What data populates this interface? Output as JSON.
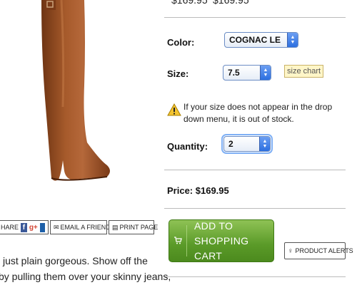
{
  "product": {
    "prices_top": [
      "$169.95",
      "$169.95"
    ],
    "color_label": "Color:",
    "color_value": "COGNAC LE",
    "size_label": "Size:",
    "size_value": "7.5",
    "size_chart": "size chart",
    "stock_notice_line1": "If your size does not appear in the drop",
    "stock_notice_line2": "down menu, it is out of stock.",
    "quantity_label": "Quantity:",
    "quantity_value": "2",
    "price_label": "Price:",
    "price_value": "$169.95",
    "add_to_cart_line1": "ADD TO",
    "add_to_cart_line2": "SHOPPING CART",
    "product_alerts": "PRODUCT ALERTS"
  },
  "share": {
    "share_label": "HARE",
    "email_label": "EMAIL A FRIEND",
    "print_label": "PRINT PAGE"
  },
  "description": {
    "line1": "just plain gorgeous. Show off the",
    "line2": "by pulling them over your skinny jeans,"
  },
  "colors": {
    "boot": "#9b4f25",
    "button_green": "#5a9a28",
    "select_border": "#6a8cc4"
  }
}
